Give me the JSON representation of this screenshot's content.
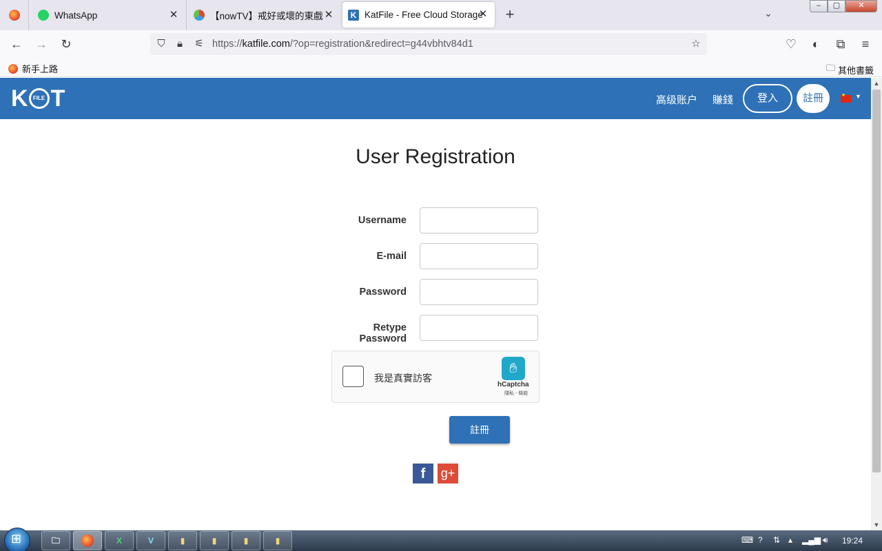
{
  "browser": {
    "tabs": [
      {
        "title": "WhatsApp"
      },
      {
        "title": "【nowTV】戒好或壞的東戲 全"
      },
      {
        "title": "KatFile - Free Cloud Storage"
      }
    ],
    "url": {
      "scheme": "https://",
      "domain": "katfile.com",
      "path": "/?op=registration&redirect=g44vbhtv84d1"
    },
    "bookmarks": {
      "getting_started": "新手上路",
      "other": "其他書籤"
    }
  },
  "site": {
    "logo": {
      "left": "K",
      "circle": "FILE",
      "right": "T"
    },
    "nav": {
      "premium": "高级账户",
      "earn": "賺錢",
      "login": "登入",
      "register": "註冊"
    },
    "title": "User Registration",
    "form": {
      "username_label": "Username",
      "email_label": "E-mail",
      "password_label": "Password",
      "retype_label": "Retype Password",
      "username_value": "",
      "email_value": "",
      "password_value": "",
      "retype_value": ""
    },
    "captcha": {
      "label": "我是真實訪客",
      "brand": "hCaptcha",
      "terms": "隱私 - 條款"
    },
    "submit_label": "註冊",
    "social": {
      "facebook": "f",
      "google": "g+"
    }
  },
  "taskbar": {
    "clock": "19:24"
  },
  "icons": {
    "firefox": "firefox-icon",
    "whatsapp": "whatsapp-icon",
    "katfile": "katfile-icon"
  },
  "colors": {
    "brand_blue": "#2e71b6",
    "facebook": "#3b5998",
    "google_plus": "#dd4b39",
    "hcaptcha": "#1fa8c9"
  }
}
